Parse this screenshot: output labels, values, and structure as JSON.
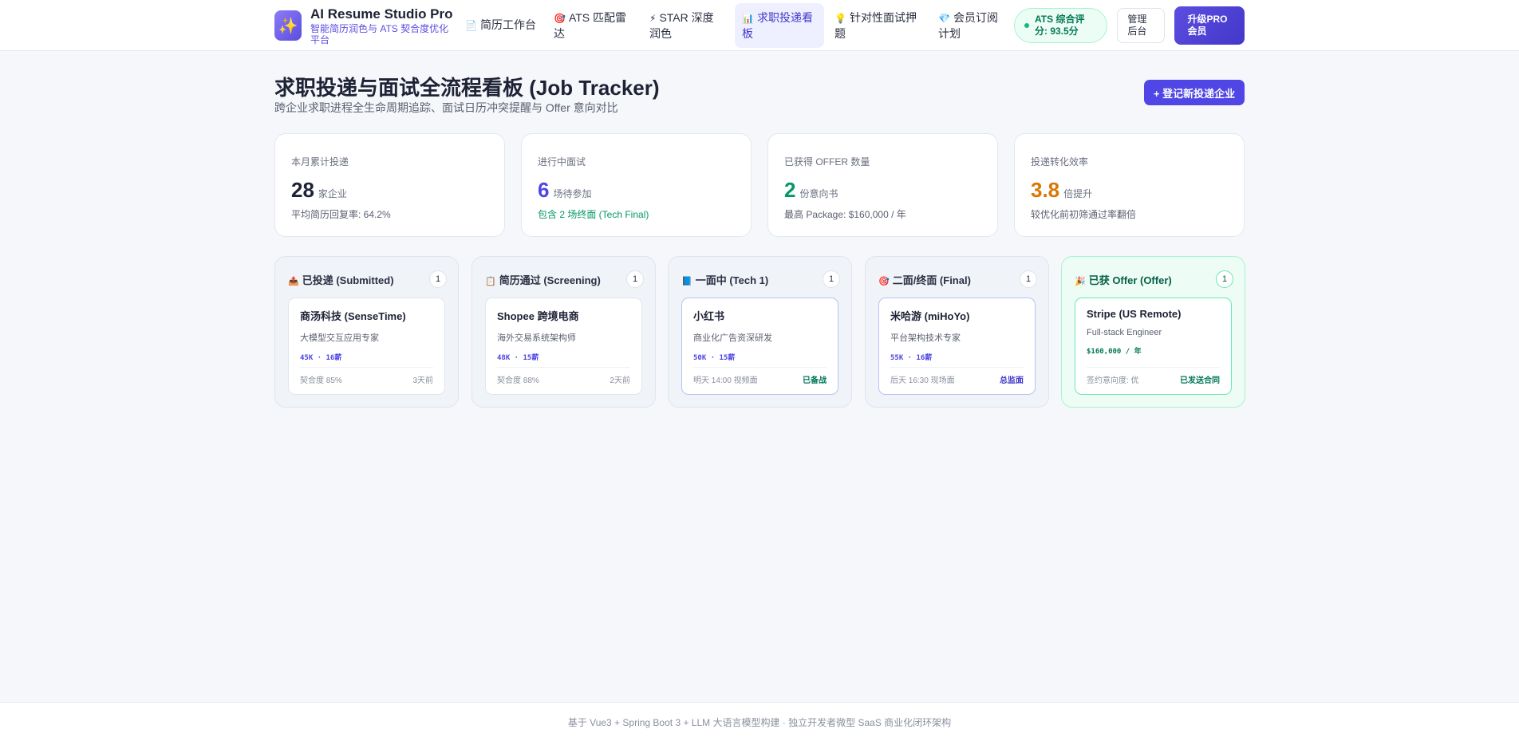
{
  "brand": {
    "logo_icon": "sparkles-icon",
    "title": "AI Resume Studio Pro",
    "subtitle": "智能简历润色与 ATS 契合度优化平台"
  },
  "nav": [
    {
      "icon": "📄",
      "label": "简历工作台"
    },
    {
      "icon": "🎯",
      "label": "ATS 匹配雷达"
    },
    {
      "icon": "⚡",
      "label": "STAR 深度润色"
    },
    {
      "icon": "📊",
      "label": "求职投递看板",
      "active": true
    },
    {
      "icon": "💡",
      "label": "针对性面试押题"
    },
    {
      "icon": "💎",
      "label": "会员订阅计划"
    }
  ],
  "ats_badge": "ATS 综合评分: 93.5分",
  "admin_label": "管理后台",
  "pro_label": "升级PRO会员",
  "page": {
    "title": "求职投递与面试全流程看板 (Job Tracker)",
    "subtitle": "跨企业求职进程全生命周期追踪、面试日历冲突提醒与 Offer 意向对比",
    "add_button": "+ 登记新投递企业"
  },
  "stats": [
    {
      "label": "本月累计投递",
      "value": "28",
      "unit": "家企业",
      "note": "平均简历回复率: 64.2%",
      "color": "#1e2235"
    },
    {
      "label": "进行中面试",
      "value": "6",
      "unit": "场待参加",
      "note": "包含 2 场终面 (Tech Final)",
      "color": "#4f46e5"
    },
    {
      "label": "已获得 OFFER 数量",
      "value": "2",
      "unit": "份意向书",
      "note": "最高 Package: $160,000 / 年",
      "color": "#059669"
    },
    {
      "label": "投递转化效率",
      "value": "3.8",
      "unit": "倍提升",
      "note": "较优化前初筛通过率翻倍",
      "color": "#d97706"
    }
  ],
  "columns": [
    {
      "icon": "📤",
      "title": "已投递 (Submitted)",
      "count": "1",
      "card": {
        "company": "商汤科技 (SenseTime)",
        "role": "大模型交互应用专家",
        "salary": "45K · 16薪",
        "foot_left": "契合度 85%",
        "foot_right": "3天前"
      }
    },
    {
      "icon": "📋",
      "title": "简历通过 (Screening)",
      "count": "1",
      "card": {
        "company": "Shopee 跨境电商",
        "role": "海外交易系统架构师",
        "salary": "48K · 15薪",
        "foot_left": "契合度 88%",
        "foot_right": "2天前"
      }
    },
    {
      "icon": "📘",
      "title": "一面中 (Tech 1)",
      "count": "1",
      "card": {
        "company": "小红书",
        "role": "商业化广告资深研发",
        "salary": "50K · 15薪",
        "foot_left": "明天 14:00 视频面",
        "foot_right": "已备战"
      }
    },
    {
      "icon": "🎯",
      "title": "二面/终面 (Final)",
      "count": "1",
      "card": {
        "company": "米哈游 (miHoYo)",
        "role": "平台架构技术专家",
        "salary": "55K · 16薪",
        "foot_left": "后天 16:30 现场面",
        "foot_right": "总监面"
      }
    },
    {
      "icon": "🎉",
      "title": "已获 Offer (Offer)",
      "count": "1",
      "card": {
        "company": "Stripe (US Remote)",
        "role": "Full-stack Engineer",
        "salary": "$160,000 / 年",
        "foot_left": "签约意向度: 优",
        "foot_right": "已发送合同"
      }
    }
  ],
  "footer": "基于 Vue3 + Spring Boot 3 + LLM 大语言模型构建 · 独立开发者微型 SaaS 商业化闭环架构"
}
